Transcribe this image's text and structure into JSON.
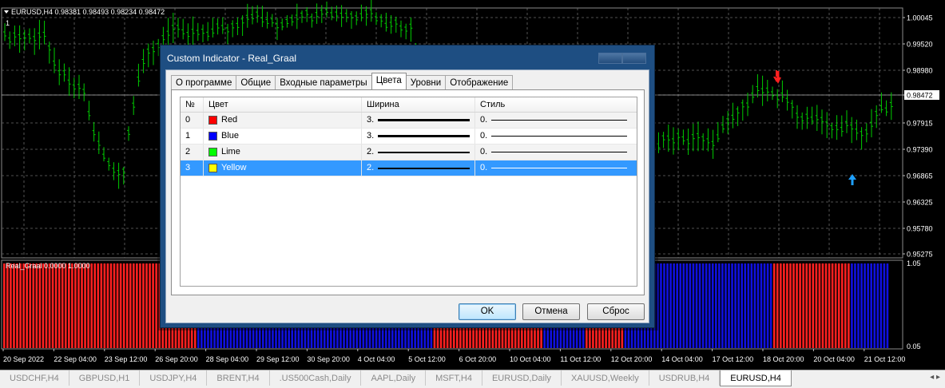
{
  "window": {
    "symbol_label": "EURUSD,H4  0.98381 0.98493 0.98234 0.98472",
    "subwindow_marker": "1",
    "indicator_label": "Real_Graal 0.0000 1.0000"
  },
  "colors": {
    "background": "#000000",
    "grid": "#6a6a6a",
    "candle": "#00cc00",
    "indicator_red": "#ff2020",
    "indicator_blue": "#1010e0",
    "sell_arrow": "#ff2020",
    "buy_arrow": "#1ea0ff",
    "selection": "#3399ff"
  },
  "price_axis": {
    "labels": [
      "1.00045",
      "0.99520",
      "0.98980",
      "0.98472",
      "0.97915",
      "0.97390",
      "0.96865",
      "0.96325",
      "0.95780",
      "0.95275"
    ],
    "current_price": "0.98472",
    "indicator_top": "1.05",
    "indicator_bottom": "0.05"
  },
  "time_axis": {
    "labels": [
      "20 Sep 2022",
      "22 Sep 04:00",
      "23 Sep 12:00",
      "26 Sep 20:00",
      "28 Sep 04:00",
      "29 Sep 12:00",
      "30 Sep 20:00",
      "4 Oct 04:00",
      "5 Oct 12:00",
      "6 Oct 20:00",
      "10 Oct 04:00",
      "11 Oct 12:00",
      "12 Oct 20:00",
      "14 Oct 04:00",
      "17 Oct 12:00",
      "18 Oct 20:00",
      "20 Oct 04:00",
      "21 Oct 12:00"
    ]
  },
  "dialog": {
    "title": "Custom Indicator - Real_Graal",
    "tabs": [
      "О программе",
      "Общие",
      "Входные параметры",
      "Цвета",
      "Уровни",
      "Отображение"
    ],
    "active_tab": "Цвета",
    "columns": [
      "№",
      "Цвет",
      "Ширина",
      "Стиль"
    ],
    "rows": [
      {
        "no": "0",
        "color_name": "Red",
        "swatch": "#ff0000",
        "width": "3.",
        "style": "0."
      },
      {
        "no": "1",
        "color_name": "Blue",
        "swatch": "#0000ff",
        "width": "3.",
        "style": "0."
      },
      {
        "no": "2",
        "color_name": "Lime",
        "swatch": "#00ff00",
        "width": "2.",
        "style": "0."
      },
      {
        "no": "3",
        "color_name": "Yellow",
        "swatch": "#ffff00",
        "width": "2.",
        "style": "0."
      }
    ],
    "selected_row": 3,
    "buttons": {
      "ok": "OK",
      "cancel": "Отмена",
      "reset": "Сброс"
    }
  },
  "symbol_tabs": [
    "USDCHF,H4",
    "GBPUSD,H1",
    "USDJPY,H4",
    "BRENT,H4",
    ".US500Cash,Daily",
    "AAPL,Daily",
    "MSFT,H4",
    "EURUSD,Daily",
    "XAUUSD,Weekly",
    "USDRUB,H4",
    "EURUSD,H4"
  ],
  "active_symbol_tab": "EURUSD,H4",
  "scroll_arrows": "◂ ▸"
}
